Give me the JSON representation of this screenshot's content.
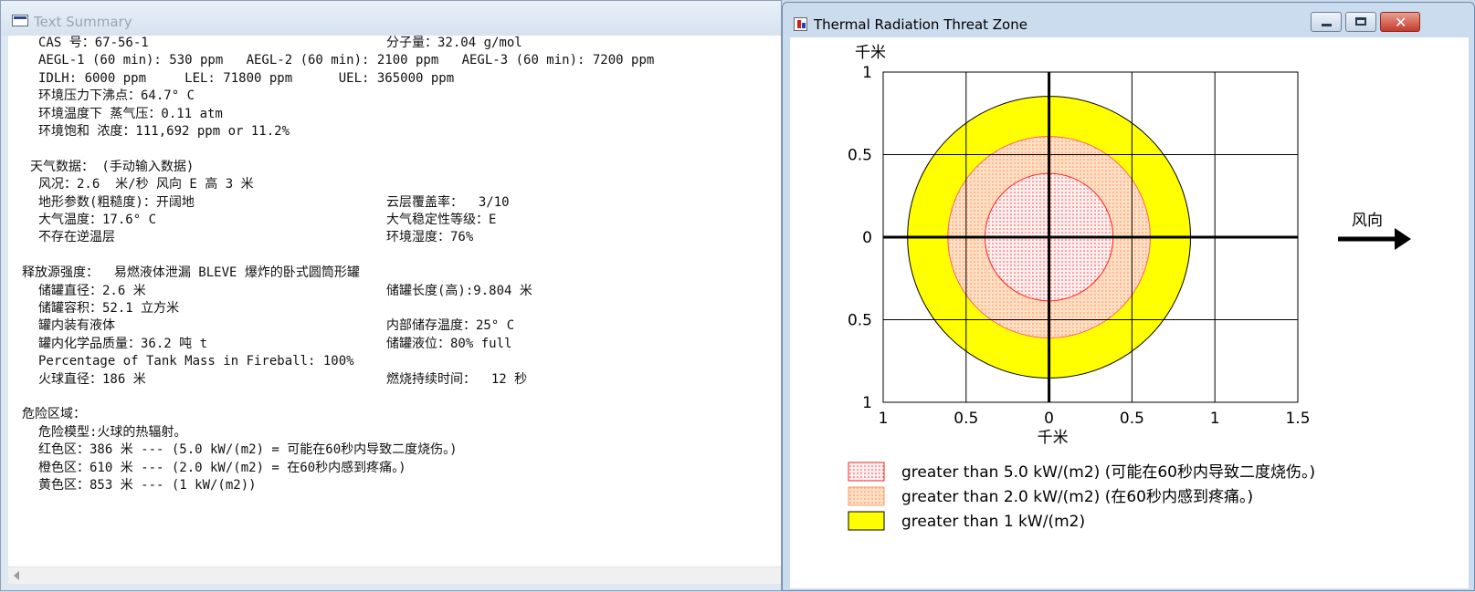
{
  "left_window": {
    "title": "Text Summary",
    "lines": [
      {
        "a": "CAS 号：67-56-1",
        "b": "分子量：32.04 g/mol",
        "indent": 1
      },
      {
        "a": "AEGL-1 (60 min): 530 ppm   AEGL-2 (60 min): 2100 ppm   AEGL-3 (60 min): 7200 ppm",
        "b": "",
        "indent": 1
      },
      {
        "a": "IDLH: 6000 ppm     LEL: 71800 ppm      UEL: 365000 ppm",
        "b": "",
        "indent": 1
      },
      {
        "a": "环境压力下沸点：64.7° C",
        "b": "",
        "indent": 1
      },
      {
        "a": "环境温度下 蒸气压：0.11 atm",
        "b": "",
        "indent": 1
      },
      {
        "a": "环境饱和 浓度：111,692 ppm or 11.2%",
        "b": "",
        "indent": 1
      },
      {
        "a": "",
        "b": "",
        "indent": 1
      },
      {
        "a": "天气数据： (手动输入数据)",
        "b": "",
        "indent": 0.5
      },
      {
        "a": "风况：2.6  米/秒 风向 E 高 3 米",
        "b": "",
        "indent": 1
      },
      {
        "a": "地形参数(粗糙度)：开阔地",
        "b": "云层覆盖率：  3/10",
        "indent": 1
      },
      {
        "a": "大气温度：17.6° C",
        "b": "大气稳定性等级：E",
        "indent": 1
      },
      {
        "a": "不存在逆温层",
        "b": "环境湿度：76%",
        "indent": 1
      },
      {
        "a": "",
        "b": "",
        "indent": 1
      },
      {
        "a": "释放源强度：  易燃液体泄漏 BLEVE 爆炸的卧式圆筒形罐",
        "b": "",
        "indent": 0
      },
      {
        "a": "储罐直径：2.6 米",
        "b": "储罐长度(高):9.804 米",
        "indent": 1
      },
      {
        "a": "储罐容积：52.1 立方米",
        "b": "",
        "indent": 1
      },
      {
        "a": "罐内装有液体",
        "b": "内部储存温度：25° C",
        "indent": 1
      },
      {
        "a": "罐内化学品质量：36.2 吨 t",
        "b": "储罐液位：80% full",
        "indent": 1
      },
      {
        "a": "Percentage of Tank Mass in Fireball: 100%",
        "b": "",
        "indent": 1
      },
      {
        "a": "火球直径：186 米",
        "b": "燃烧持续时间：  12 秒",
        "indent": 1
      },
      {
        "a": "",
        "b": "",
        "indent": 1
      },
      {
        "a": "危险区域：",
        "b": "",
        "indent": 0
      },
      {
        "a": "危险模型:火球的热辐射。",
        "b": "",
        "indent": 1
      },
      {
        "a": "红色区：386 米 --- (5.0 kW/(m2) = 可能在60秒内导致二度烧伤。)",
        "b": "",
        "indent": 1
      },
      {
        "a": "橙色区：610 米 --- (2.0 kW/(m2) = 在60秒内感到疼痛。)",
        "b": "",
        "indent": 1
      },
      {
        "a": "黄色区：853 米 --- (1 kW/(m2))",
        "b": "",
        "indent": 1
      }
    ]
  },
  "right_window": {
    "title": "Thermal Radiation Threat Zone",
    "buttons": {
      "minimize": "minimize",
      "maximize": "maximize",
      "close": "close"
    }
  },
  "chart_data": {
    "type": "threat-zone-plot",
    "xlabel": "千米",
    "ylabel": "千米",
    "x_ticks": [
      "1",
      "0.5",
      "0",
      "0.5",
      "1",
      "1.5"
    ],
    "x_tick_values": [
      -1,
      -0.5,
      0,
      0.5,
      1,
      1.5
    ],
    "y_ticks": [
      "1",
      "0.5",
      "0",
      "0.5",
      "1"
    ],
    "y_tick_values": [
      1,
      0.5,
      0,
      -0.5,
      -1
    ],
    "xlim": [
      -1,
      1.5
    ],
    "ylim": [
      -1,
      1
    ],
    "grid": true,
    "wind_label": "风向",
    "wind_direction": "east",
    "zones": [
      {
        "name": "yellow",
        "radius_km": 0.853,
        "fill": "#ffff00",
        "stroke": "#000000",
        "pattern": "solid"
      },
      {
        "name": "orange",
        "radius_km": 0.61,
        "fill": "#ffd9b8",
        "stroke": "#ff6060",
        "pattern": "dots-orange"
      },
      {
        "name": "red",
        "radius_km": 0.386,
        "fill": "#ffecec",
        "stroke": "#ff2020",
        "pattern": "dots-red"
      }
    ],
    "legend": [
      {
        "text": "greater than 5.0 kW/(m2) (可能在60秒内导致二度烧伤。)",
        "swatch": "red"
      },
      {
        "text": "greater than 2.0 kW/(m2) (在60秒内感到疼痛。)",
        "swatch": "orange"
      },
      {
        "text": "greater than 1 kW/(m2)",
        "swatch": "yellow"
      }
    ],
    "legend_position": "bottom"
  }
}
